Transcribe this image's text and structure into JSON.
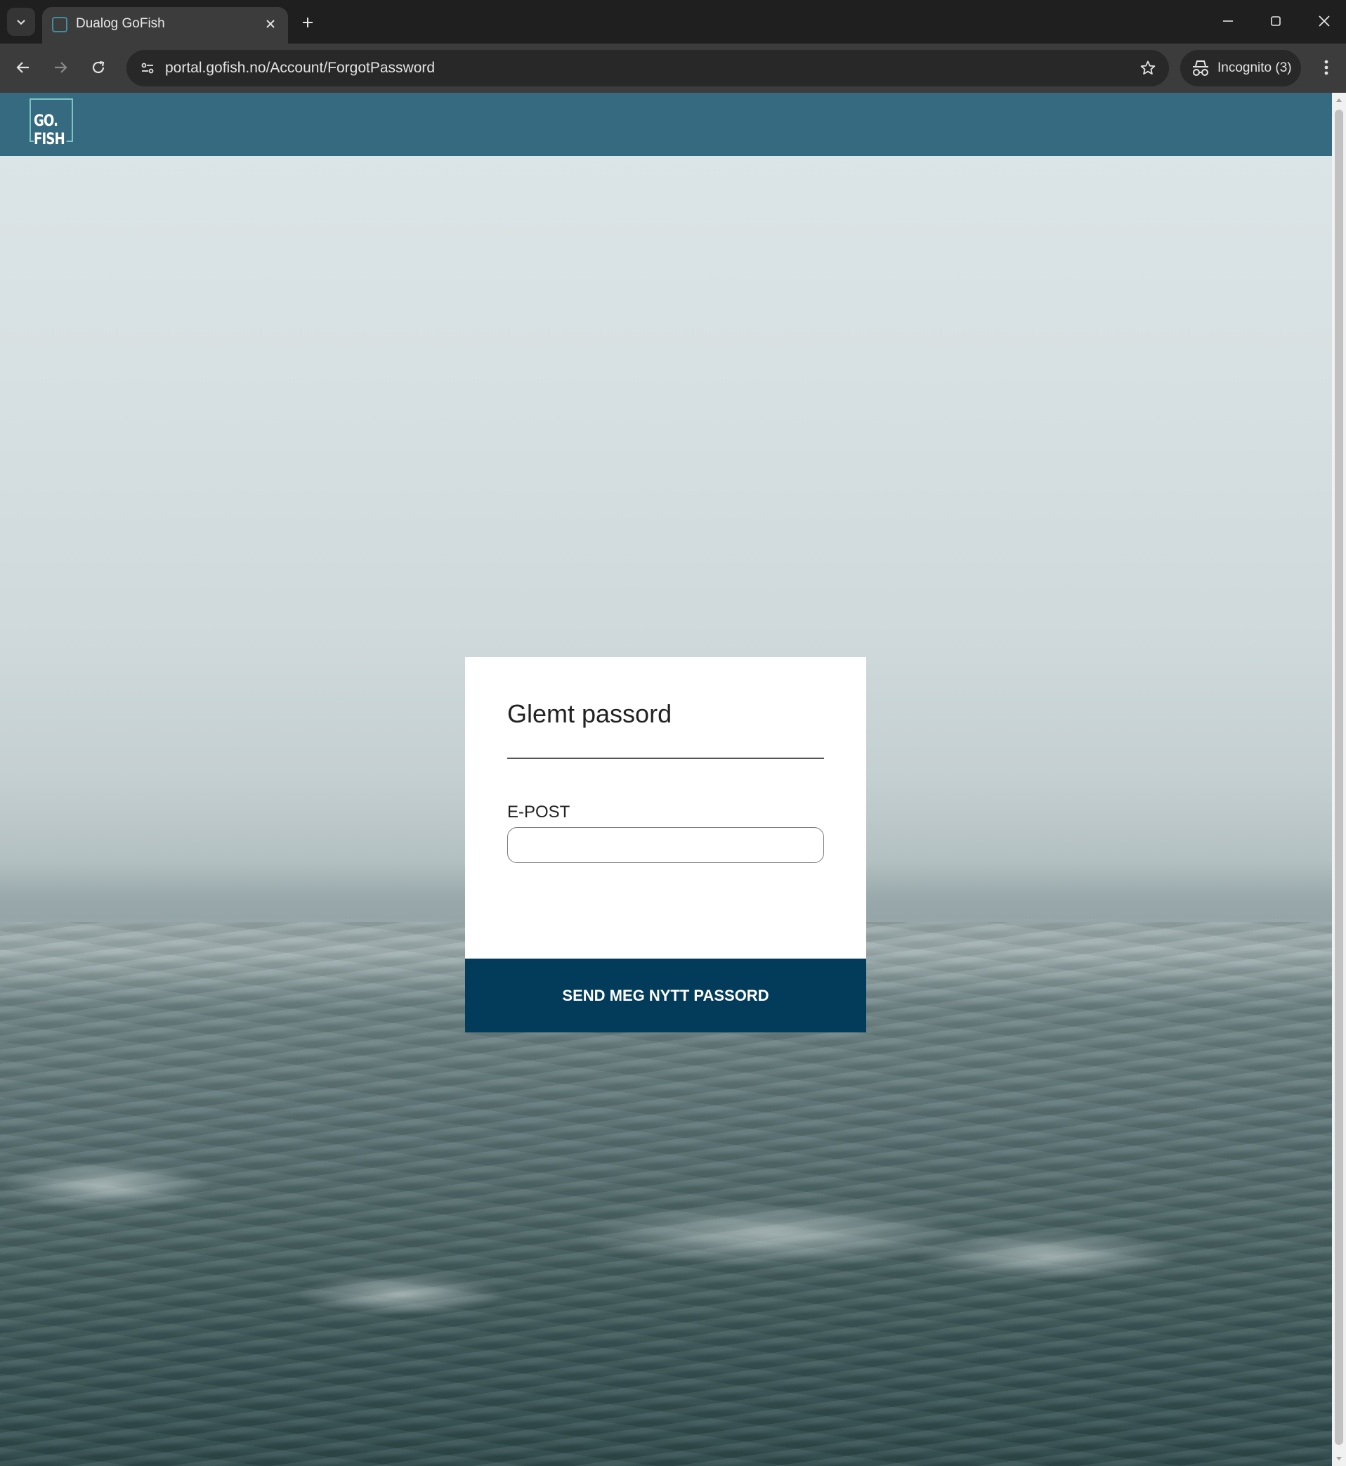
{
  "browser": {
    "tab_title": "Dualog GoFish",
    "url": "portal.gofish.no/Account/ForgotPassword",
    "incognito_label": "Incognito (3)"
  },
  "header": {
    "logo_line1": "GO.",
    "logo_line2": "FISH"
  },
  "form": {
    "title": "Glemt passord",
    "email_label": "E-POST",
    "email_value": "",
    "submit_label": "SEND MEG NYTT PASSORD"
  },
  "colors": {
    "header_bg": "#356a80",
    "button_bg": "#033c5a",
    "logo_accent": "#7fc4c2",
    "chrome_bg": "#1f1f1f",
    "toolbar_bg": "#3c3c3c"
  },
  "icons": {
    "tab_search": "chevron-down-icon",
    "tab_favicon": "gofish-favicon-icon",
    "tab_close": "close-icon",
    "new_tab": "plus-icon",
    "back": "arrow-left-icon",
    "forward": "arrow-right-icon",
    "reload": "reload-icon",
    "site_info": "tune-icon",
    "bookmark": "star-icon",
    "incognito": "incognito-icon",
    "menu": "kebab-menu-icon",
    "minimize": "minimize-icon",
    "maximize": "maximize-icon",
    "close_window": "close-icon"
  }
}
